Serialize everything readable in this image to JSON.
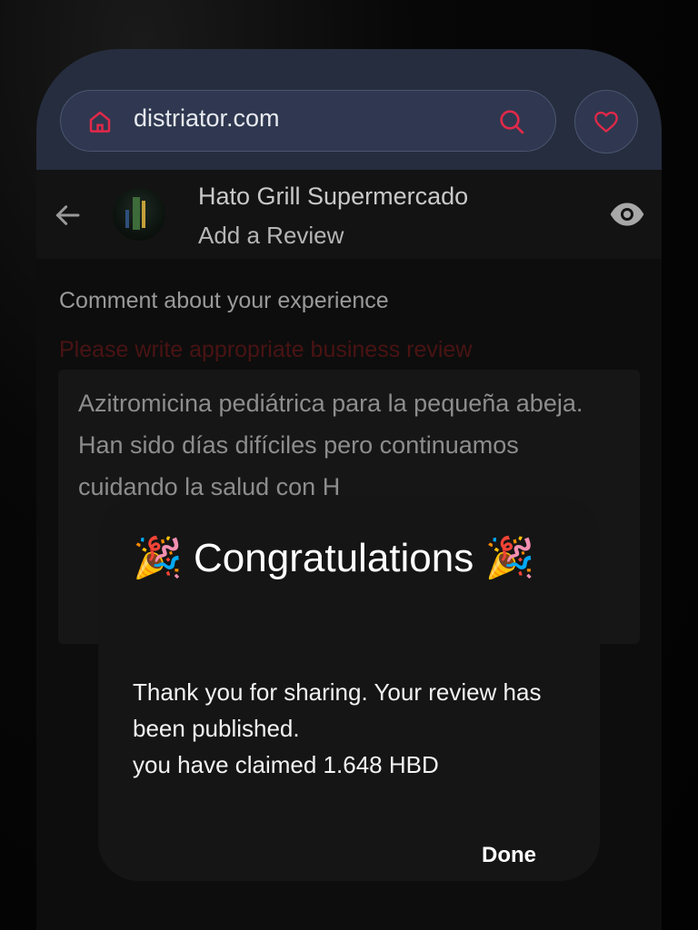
{
  "browser": {
    "url": "distriator.com",
    "accent_color": "#e0294a"
  },
  "header": {
    "title": "Hato Grill Supermercado",
    "subtitle": "Add a Review"
  },
  "form": {
    "comment_label": "Comment about your experience",
    "error_text": "Please write appropriate business review",
    "review_text": "Azitromicina pediátrica para la pequeña abeja. Han sido días difíciles pero continuamos cuidando la salud con H"
  },
  "dialog": {
    "emoji": "🎉",
    "title": "Congratulations",
    "line1": "Thank you for sharing. Your review has been published.",
    "line2": "you have claimed 1.648 HBD",
    "done_label": "Done"
  },
  "icons": {
    "home": "home-icon",
    "search": "search-icon",
    "heart": "heart-icon",
    "back": "arrow-left-icon",
    "eye": "eye-icon"
  }
}
